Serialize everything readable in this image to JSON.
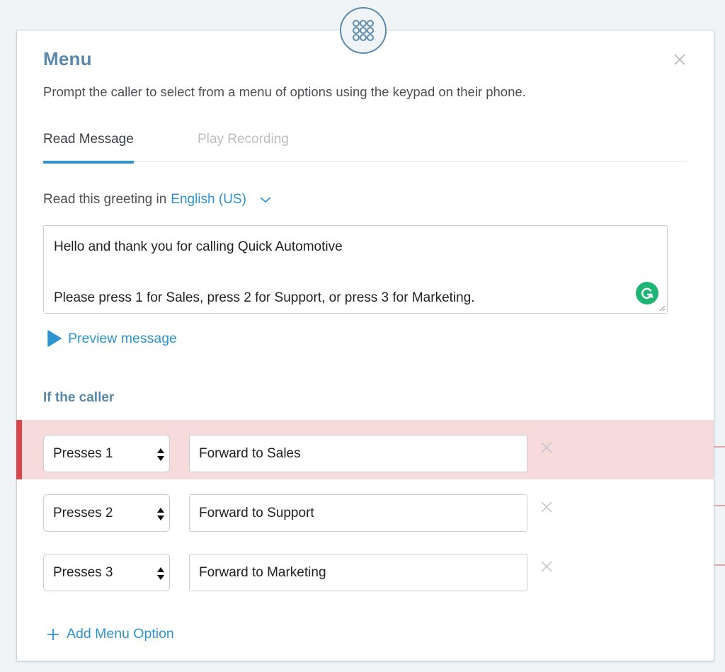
{
  "panel": {
    "node_icon": "keypad-icon",
    "title": "Menu",
    "description": "Prompt the caller to select from a menu of options using the keypad on their phone.",
    "close_icon": "close-icon"
  },
  "tabs": [
    {
      "label": "Read Message",
      "active": true
    },
    {
      "label": "Play Recording",
      "active": false
    }
  ],
  "language": {
    "prefix": "Read this greeting in",
    "selected": "English (US)",
    "chevron_icon": "chevron-down-icon"
  },
  "greeting": {
    "lines": [
      "Hello and thank you for calling Quick Automotive",
      "",
      "Please press 1 for Sales, press 2 for Support, or press 3 for Marketing."
    ],
    "grammarly_icon": "grammarly-icon"
  },
  "preview": {
    "label": "Preview message",
    "icon": "play-icon"
  },
  "caller_section": {
    "heading": "If the caller",
    "options": [
      {
        "key": "Presses 1",
        "action": "Forward to Sales",
        "highlighted": true
      },
      {
        "key": "Presses 2",
        "action": "Forward to Support",
        "highlighted": false
      },
      {
        "key": "Presses 3",
        "action": "Forward to Marketing",
        "highlighted": false
      }
    ],
    "add_label": "Add Menu Option"
  },
  "colors": {
    "accent": "#2e93d1",
    "heading": "#5a88aa",
    "error_row_bg": "#f7dadb",
    "error_bar": "#d9474c",
    "grammarly": "#1fb575"
  }
}
